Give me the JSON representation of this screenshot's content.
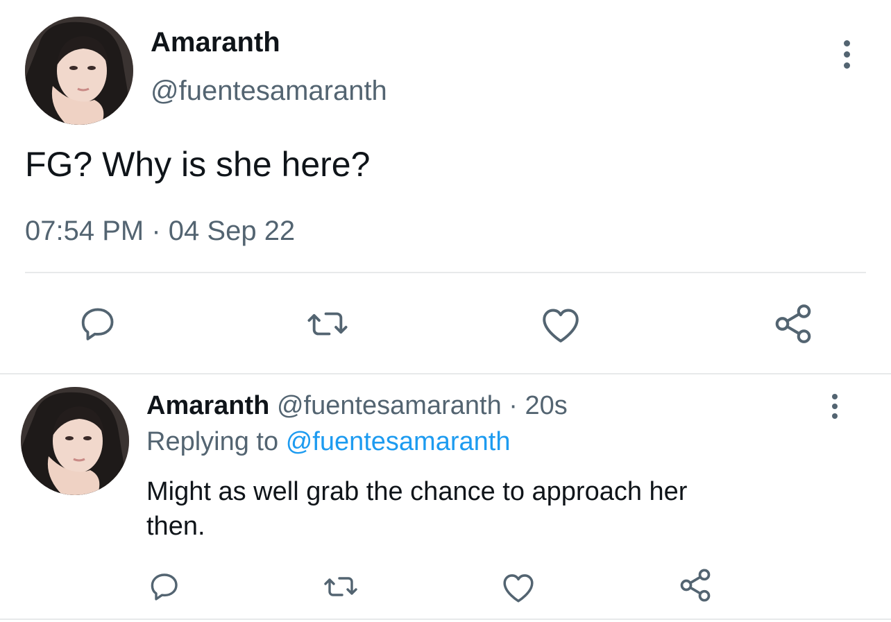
{
  "main_tweet": {
    "display_name": "Amaranth",
    "handle": "@fuentesamaranth",
    "text": "FG? Why is she here?",
    "time": "07:54 PM",
    "separator": "·",
    "date": "04 Sep 22"
  },
  "reply_tweet": {
    "display_name": "Amaranth",
    "handle": "@fuentesamaranth",
    "separator": "·",
    "age": "20s",
    "replying_to_label": "Replying to",
    "replying_to_handle": "@fuentesamaranth",
    "text_line1": "Might as well grab the chance to approach her",
    "text_line2": "then."
  },
  "icons": {
    "reply": "reply-icon",
    "retweet": "retweet-icon",
    "like": "heart-icon",
    "share": "share-icon",
    "more": "more-options-icon"
  },
  "colors": {
    "text": "#0f1419",
    "secondary": "#536471",
    "link": "#1d9bf0",
    "divider": "#e7e9ea"
  }
}
